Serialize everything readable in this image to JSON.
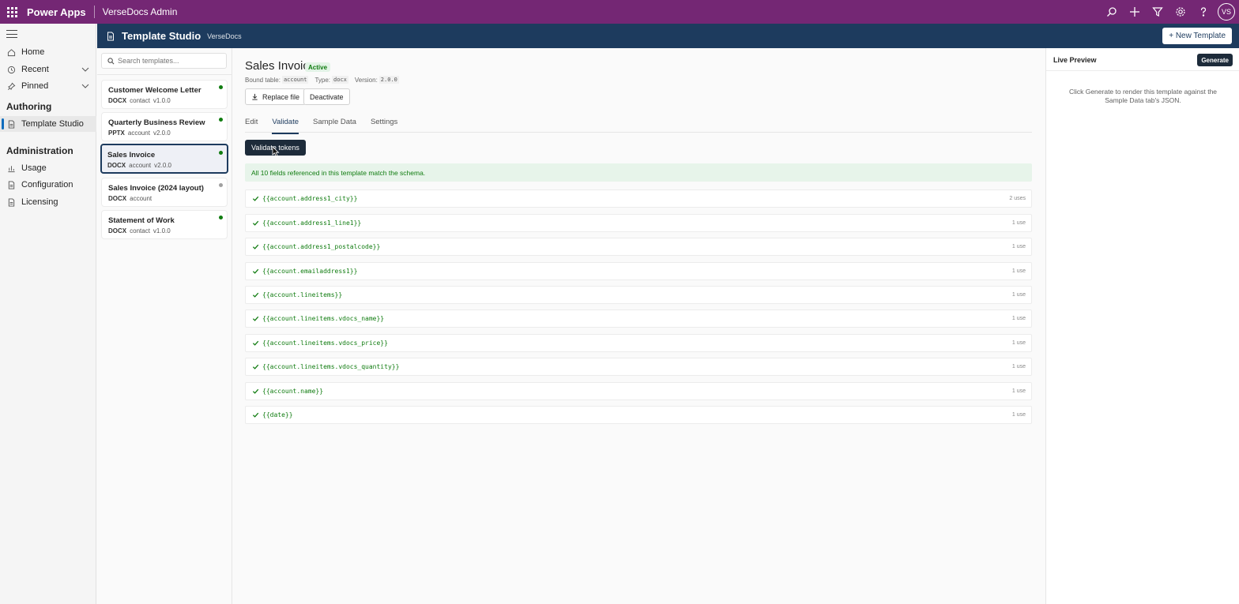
{
  "topbar": {
    "app_name": "Power Apps",
    "environment": "VerseDocs Admin",
    "avatar_initials": "VS",
    "icons": [
      "search-icon",
      "add-icon",
      "filter-icon",
      "settings-icon",
      "help-icon"
    ]
  },
  "leftnav": {
    "items_top": [
      {
        "label": "Home",
        "icon": "home-icon"
      },
      {
        "label": "Recent",
        "icon": "clock-icon"
      },
      {
        "label": "Pinned",
        "icon": "pin-icon"
      }
    ],
    "authoring_heading": "Authoring",
    "authoring_items": [
      {
        "label": "Template Studio",
        "icon": "document-icon"
      }
    ],
    "administration_heading": "Administration",
    "administration_items": [
      {
        "label": "Usage",
        "icon": "chart-icon"
      },
      {
        "label": "Configuration",
        "icon": "document-icon"
      },
      {
        "label": "Licensing",
        "icon": "document-icon"
      }
    ]
  },
  "header": {
    "title": "Template Studio",
    "subtitle": "VerseDocs",
    "new_template_label": "+ New Template"
  },
  "template_list": {
    "search_placeholder": "Search templates...",
    "items": [
      {
        "name": "Customer Welcome Letter",
        "format": "DOCX",
        "table": "contact",
        "version": "v1.0.0",
        "status_color": "#107c10"
      },
      {
        "name": "Quarterly Business Review",
        "format": "PPTX",
        "table": "account",
        "version": "v2.0.0",
        "status_color": "#107c10"
      },
      {
        "name": "Sales Invoice",
        "format": "DOCX",
        "table": "account",
        "version": "v2.0.0",
        "status_color": "#107c10"
      },
      {
        "name": "Sales Invoice (2024 layout)",
        "format": "DOCX",
        "table": "account",
        "version": "",
        "status_color": "#a0a0a0"
      },
      {
        "name": "Statement of Work",
        "format": "DOCX",
        "table": "contact",
        "version": "v1.0.0",
        "status_color": "#107c10"
      }
    ]
  },
  "detail": {
    "title": "Sales Invoice",
    "status": "Active",
    "bound_table_label": "Bound table:",
    "bound_table_value": "account",
    "type_label": "Type:",
    "type_value": "docx",
    "version_label": "Version:",
    "version_value": "2.0.0",
    "replace_file_label": "Replace file",
    "deactivate_label": "Deactivate",
    "tabs": [
      "Edit",
      "Validate",
      "Sample Data",
      "Settings"
    ],
    "active_tab": "Validate",
    "validate_button_label": "Validate tokens",
    "success_message": "All 10 fields referenced in this template match the schema.",
    "tokens": [
      {
        "token": "{{account.address1_city}}",
        "uses": "2 uses"
      },
      {
        "token": "{{account.address1_line1}}",
        "uses": "1 use"
      },
      {
        "token": "{{account.address1_postalcode}}",
        "uses": "1 use"
      },
      {
        "token": "{{account.emailaddress1}}",
        "uses": "1 use"
      },
      {
        "token": "{{account.lineitems}}",
        "uses": "1 use"
      },
      {
        "token": "{{account.lineitems.vdocs_name}}",
        "uses": "1 use"
      },
      {
        "token": "{{account.lineitems.vdocs_price}}",
        "uses": "1 use"
      },
      {
        "token": "{{account.lineitems.vdocs_quantity}}",
        "uses": "1 use"
      },
      {
        "token": "{{account.name}}",
        "uses": "1 use"
      },
      {
        "token": "{{date}}",
        "uses": "1 use"
      }
    ]
  },
  "preview": {
    "title": "Live Preview",
    "generate_label": "Generate",
    "message": "Click Generate to render this template against the Sample Data tab's JSON."
  },
  "colors": {
    "topbar": "#742774",
    "header": "#1d3b5e",
    "success": "#107c10",
    "dark_button": "#1d2b3a"
  }
}
